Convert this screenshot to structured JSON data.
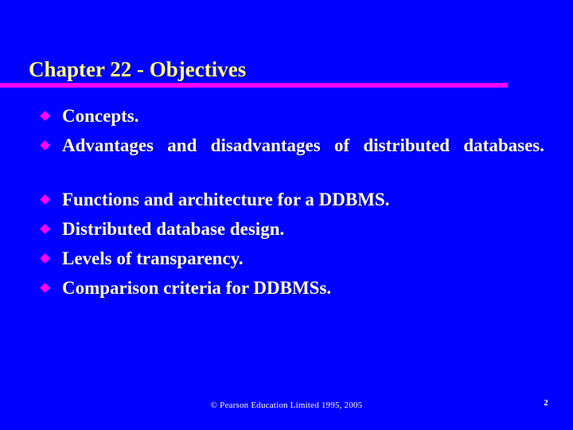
{
  "slide": {
    "background_color": "#0000FF",
    "title": "Chapter 22 - Objectives",
    "title_color": "#FFFF99",
    "rule_color": "#FF00FF",
    "bullet_color": "#FF00FF",
    "body_text_color": "#FFFFFF"
  },
  "bullets": [
    {
      "text": "Concepts."
    },
    {
      "text": "Advantages and disadvantages of distributed databases."
    },
    {
      "text": "Functions and architecture for a DDBMS."
    },
    {
      "text": "Distributed database design."
    },
    {
      "text": "Levels of transparency."
    },
    {
      "text": "Comparison criteria for DDBMSs."
    }
  ],
  "footer": {
    "copyright": "© Pearson Education Limited 1995, 2005",
    "page_number": "2"
  },
  "icons": {
    "bullet": "diamond-bullet-icon"
  }
}
